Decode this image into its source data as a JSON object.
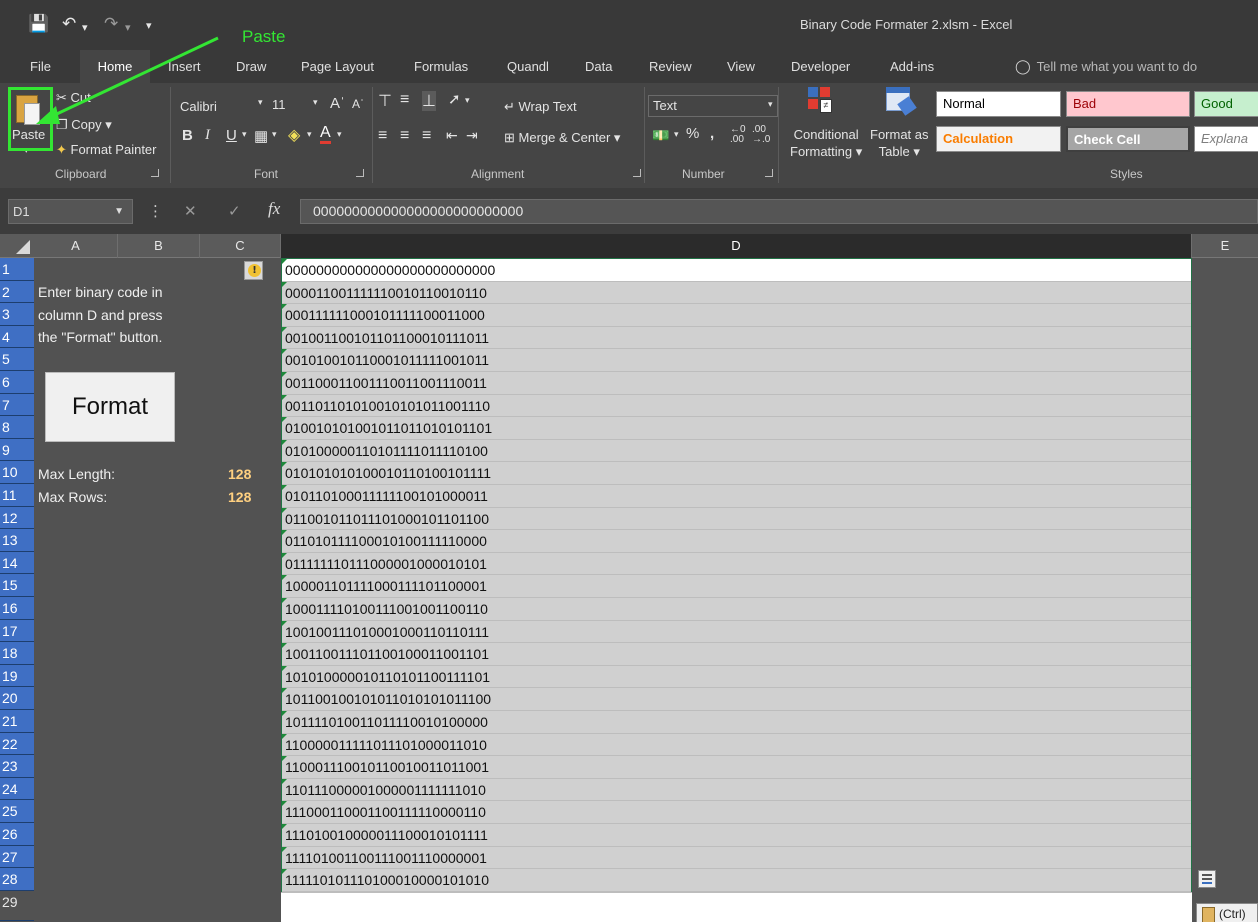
{
  "app": {
    "doc_title": "Binary Code Formater 2.xlsm  -  Excel"
  },
  "qat": {
    "save_icon": "save-icon",
    "undo_icon": "undo-icon",
    "redo_icon": "redo-icon"
  },
  "tabs": [
    "File",
    "Home",
    "Insert",
    "Draw",
    "Page Layout",
    "Formulas",
    "Quandl",
    "Data",
    "Review",
    "View",
    "Developer",
    "Add-ins"
  ],
  "active_tab": "Home",
  "tell_me": "Tell me what you want to do",
  "ribbon": {
    "clipboard": {
      "paste": "Paste",
      "cut": "Cut",
      "copy": "Copy",
      "format_painter": "Format Painter",
      "label": "Clipboard"
    },
    "font": {
      "name": "Calibri",
      "size": "11",
      "label": "Font"
    },
    "alignment": {
      "wrap_text": "Wrap Text",
      "merge_center": "Merge & Center",
      "label": "Alignment"
    },
    "number": {
      "format": "Text",
      "label": "Number"
    },
    "styles": {
      "conditional_formatting": [
        "Conditional",
        "Formatting"
      ],
      "format_as_table": [
        "Format as",
        "Table"
      ],
      "cells": [
        {
          "name": "Normal",
          "bg": "#ffffff",
          "fg": "#000000"
        },
        {
          "name": "Bad",
          "bg": "#ffc7ce",
          "fg": "#9c0006"
        },
        {
          "name": "Good",
          "bg": "#c6efce",
          "fg": "#006100"
        },
        {
          "name": "Calculation",
          "bg": "#f2f2f2",
          "fg": "#fa7d00"
        },
        {
          "name": "Check Cell",
          "bg": "#a5a5a5",
          "fg": "#ffffff"
        },
        {
          "name": "Explana",
          "bg": "#ffffff",
          "fg": "#7f7f7f"
        }
      ],
      "label": "Styles"
    }
  },
  "formula_bar": {
    "name_box": "D1",
    "fx": "fx",
    "value": "000000000000000000000000000"
  },
  "grid": {
    "columns": [
      "A",
      "B",
      "C",
      "D",
      "E"
    ],
    "selected_column": "D",
    "rows": [
      "1",
      "2",
      "3",
      "4",
      "5",
      "6",
      "7",
      "8",
      "9",
      "10",
      "11",
      "12",
      "13",
      "14",
      "15",
      "16",
      "17",
      "18",
      "19",
      "20",
      "21",
      "22",
      "23",
      "24",
      "25",
      "26",
      "27",
      "28",
      "29"
    ],
    "instructions": [
      "Enter binary code in",
      "column D and press",
      "the \"Format\" button."
    ],
    "format_button": "Format",
    "max_length_label": "Max Length:",
    "max_length_value": "128",
    "max_rows_label": "Max Rows:",
    "max_rows_value": "128",
    "column_d": [
      "000000000000000000000000000",
      "000011001111110010110010110",
      "000111111000101111100011000",
      "001001100101101100010111011",
      "001010010110001011111001011",
      "001100011001110011001110011",
      "001101101010010101011001110",
      "010010101001011011010101101",
      "010100000110101111011110100",
      "010101010100010110100101111",
      "010110100011111100101000011",
      "011001011011101000101101100",
      "011010111100010100111110000",
      "011111110111000001000010101",
      "100001101111000111101100001",
      "100011110100111001001100110",
      "100100111010001000110110111",
      "100110011101100100011001101",
      "101010000010110101100111101",
      "101100100101011010101011100",
      "101111010011011110010100000",
      "110000011111011101000011010",
      "110001110010110010011011001",
      "110111000001000001111111010",
      "111000110001100111110000110",
      "111010010000011100010101111",
      "111101001100111001110000001",
      "111110101110100010000101010"
    ],
    "paste_options": "(Ctrl)"
  },
  "annotation": {
    "label": "Paste",
    "color": "#33e633"
  }
}
